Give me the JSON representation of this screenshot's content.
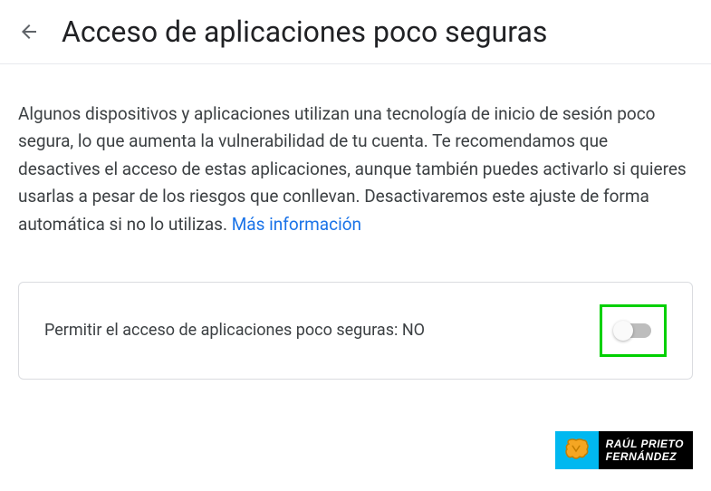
{
  "header": {
    "title": "Acceso de aplicaciones poco seguras"
  },
  "description": {
    "text": "Algunos dispositivos y aplicaciones utilizan una tecnología de inicio de sesión poco segura, lo que aumenta la vulnerabilidad de tu cuenta. Te recomendamos que desactives el acceso de estas aplicaciones, aunque también puedes activarlo si quieres usarlas a pesar de los riesgos que conllevan. Desactivaremos este ajuste de forma automática si no lo utilizas. ",
    "linkText": "Más información"
  },
  "setting": {
    "label": "Permitir el acceso de aplicaciones poco seguras: NO",
    "state": "off"
  },
  "watermark": {
    "line1": "RAÚL PRIETO",
    "line2": "FERNÁNDEZ"
  }
}
